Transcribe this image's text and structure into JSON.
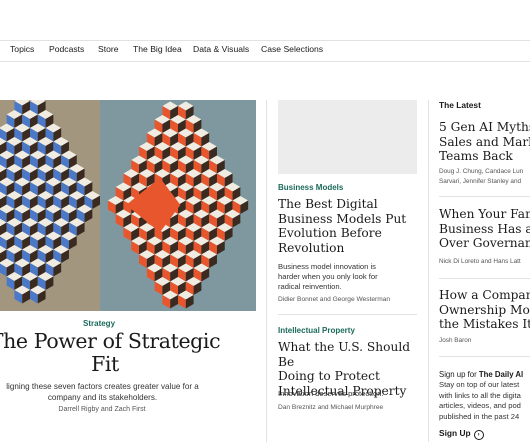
{
  "nav": {
    "items": [
      "Topics",
      "Podcasts",
      "Store",
      "The Big Idea",
      "Data & Visuals",
      "Case Selections"
    ]
  },
  "feature": {
    "kicker": "Strategy",
    "title_lines": [
      "The Power of Strategic",
      "Fit"
    ],
    "dek_lines": [
      "ligning these seven factors creates greater value for a",
      "company and its stakeholders."
    ],
    "authors": "Darrell Rigby and Zach First",
    "art_colors": {
      "left_bg": "#a3967f",
      "right_bg": "#7f989f",
      "accent_red": "#e8562e",
      "accent_blue": "#4c78c8"
    }
  },
  "middle": {
    "story1": {
      "kicker": "Business Models",
      "title_lines": [
        "The Best Digital",
        "Business Models Put",
        "Evolution Before",
        "Revolution"
      ],
      "dek_lines": [
        "Business model innovation is",
        "harder when you only look for",
        "radical reinvention."
      ],
      "authors": "Didier Bonnet and George Westerman"
    },
    "story2": {
      "kicker": "Intellectual Property",
      "title_lines": [
        "What the U.S. Should Be",
        "Doing to Protect",
        "Intellectual Property"
      ],
      "dek": "Innovation deserves protection.",
      "authors": "Dan Breznitz and Michael Murphree"
    }
  },
  "latest": {
    "heading": "The Latest",
    "stories": [
      {
        "title_lines": [
          "5 Gen AI Myths H",
          "Sales and Marke",
          "Teams Back"
        ],
        "author_lines": [
          "Doug J. Chung, Candace Lun",
          "Sarvari, Jennifer Stanley and"
        ]
      },
      {
        "title_lines": [
          "When Your Fami",
          "Business Has a C",
          "Over Governanc"
        ],
        "author_lines": [
          "Nick Di Loreto and Hans Latt"
        ]
      },
      {
        "title_lines": [
          "How a Company",
          "Ownership Mod",
          "the Mistakes It M"
        ],
        "author_lines": [
          "Josh Baron"
        ]
      }
    ],
    "signup": {
      "lead_prefix": "Sign up for ",
      "lead_bold": "The Daily Al",
      "body_lines": [
        "Stay on top of our latest",
        "with links to all the digita",
        "articles, videos, and pod",
        "published in the past 24"
      ],
      "link": "Sign Up"
    }
  }
}
